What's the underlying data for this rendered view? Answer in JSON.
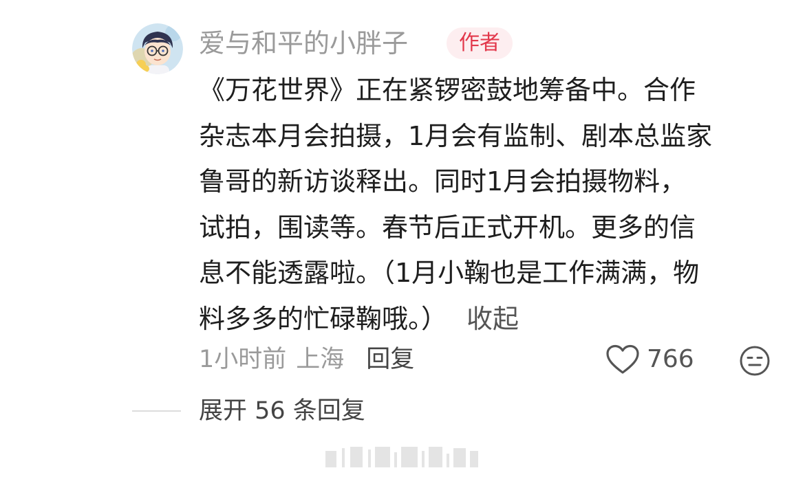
{
  "comment": {
    "username": "爱与和平的小胖子",
    "badge": "作者",
    "body_lines": [
      "《万花世界》正在紧锣密鼓地筹备中。合作",
      "杂志本月会拍摄，1月会有监制、剧本总监家",
      "鲁哥的新访谈释出。同时1月会拍摄物料，",
      "试拍，围读等。春节后正式开机。更多的信",
      "息不能透露啦。（1月小鞠也是工作满满，物",
      "料多多的忙碌鞠哦。）"
    ],
    "collapse_label": "收起",
    "time": "1小时前",
    "location": "上海",
    "reply_label": "回复",
    "like_count": "766",
    "expand_replies": "展开 56 条回复"
  },
  "icons": {
    "like": "heart-outline-icon",
    "emoji": "neutral-face-icon",
    "avatar": "cartoon-avatar"
  },
  "colors": {
    "badge_text": "#e2384b",
    "badge_bg": "#fdeef0",
    "meta_gray": "#9a9a9a"
  }
}
